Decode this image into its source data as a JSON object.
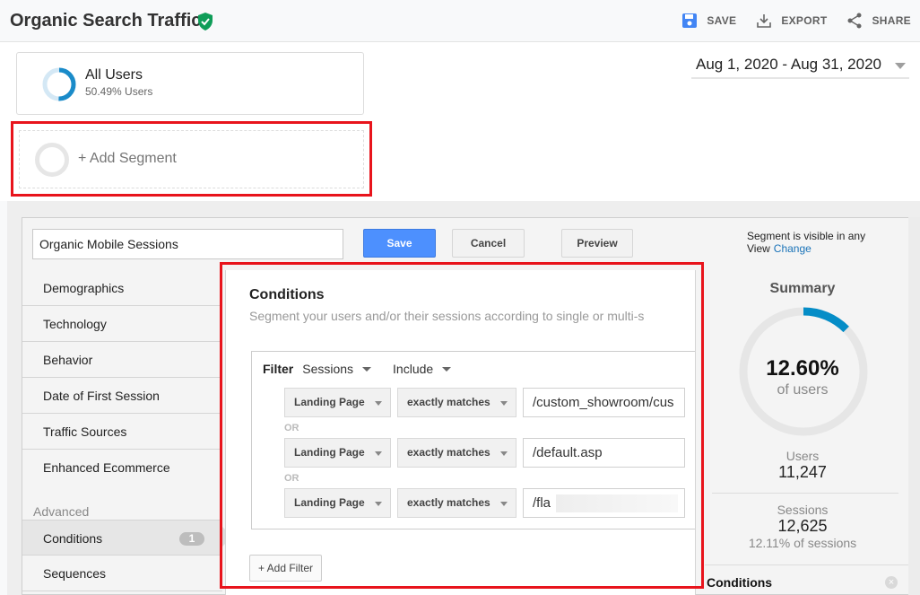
{
  "header": {
    "title": "Organic Search Traffic",
    "verified_icon": "verified-shield-icon",
    "actions": [
      {
        "label": "SAVE",
        "icon": "save-icon"
      },
      {
        "label": "EXPORT",
        "icon": "download-icon"
      },
      {
        "label": "SHARE",
        "icon": "share-icon"
      }
    ]
  },
  "segments": {
    "active": {
      "name": "All Users",
      "subtitle": "50.49% Users",
      "share": 0.5049
    },
    "add_label": "+ Add Segment"
  },
  "date_range": "Aug 1, 2020 - Aug 31, 2020",
  "builder": {
    "segment_name": "Organic Mobile Sessions",
    "buttons": {
      "save": "Save",
      "cancel": "Cancel",
      "preview": "Preview"
    },
    "visibility_text": "Segment is visible in any View",
    "visibility_link": "Change",
    "nav": {
      "items": [
        "Demographics",
        "Technology",
        "Behavior",
        "Date of First Session",
        "Traffic Sources",
        "Enhanced Ecommerce"
      ],
      "advanced_heading": "Advanced",
      "advanced_items": [
        {
          "label": "Conditions",
          "badge": "1",
          "active": true
        },
        {
          "label": "Sequences"
        }
      ]
    },
    "conditions": {
      "title": "Conditions",
      "description": "Segment your users and/or their sessions according to single or multi-s",
      "filter_label": "Filter",
      "scope": "Sessions",
      "mode": "Include",
      "or_label": "OR",
      "rows": [
        {
          "dimension": "Landing Page",
          "operator": "exactly matches",
          "value": "/custom_showroom/cus"
        },
        {
          "dimension": "Landing Page",
          "operator": "exactly matches",
          "value": "/default.asp"
        },
        {
          "dimension": "Landing Page",
          "operator": "exactly matches",
          "value": "/fla",
          "redacted": true
        }
      ],
      "add_filter": "+ Add Filter"
    },
    "summary": {
      "title": "Summary",
      "percent": "12.60%",
      "percent_value": 0.126,
      "percent_label": "of users",
      "users_label": "Users",
      "users_value": "11,247",
      "sessions_label": "Sessions",
      "sessions_value": "12,625",
      "sessions_sub": "12.11% of sessions",
      "conditions_label": "Conditions"
    }
  },
  "colors": {
    "accent_blue": "#4d90fe",
    "donut_blue": "#058dc7",
    "highlight_red": "#e8141c",
    "verified_green": "#0f9d58"
  }
}
